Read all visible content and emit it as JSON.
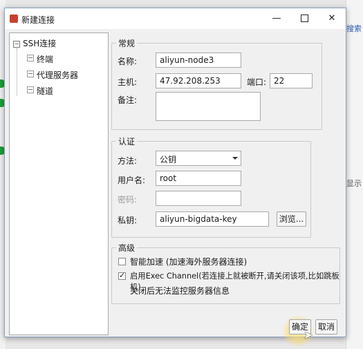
{
  "background": {
    "right_link": "搜索",
    "right_text": "显示"
  },
  "window": {
    "title": "新建连接",
    "minimize_glyph": "—",
    "close_glyph": "✕"
  },
  "tree": {
    "root": "SSH连接",
    "children": [
      "终端",
      "代理服务器",
      "隧道"
    ]
  },
  "general": {
    "legend": "常规",
    "name_label": "名称:",
    "name_value": "aliyun-node3",
    "host_label": "主机:",
    "host_value": "47.92.208.253",
    "port_label": "端口:",
    "port_value": "22",
    "note_label": "备注:",
    "note_value": ""
  },
  "auth": {
    "legend": "认证",
    "method_label": "方法:",
    "method_value": "公钥",
    "user_label": "用户名:",
    "user_value": "root",
    "password_label": "密码:",
    "password_value": "",
    "key_label": "私钥:",
    "key_value": "aliyun-bigdata-key",
    "browse_button": "浏览..."
  },
  "advanced": {
    "legend": "高级",
    "smart_accel": {
      "label": "智能加速 (加速海外服务器连接)",
      "checked": false
    },
    "exec_channel": {
      "label": "启用Exec Channel(若连接上就被断开,请关闭该项,比如跳板机)",
      "checked": true
    },
    "exec_note": "关闭后无法监控服务器信息"
  },
  "footer": {
    "ok_button": "确定",
    "cancel_button": "取消"
  },
  "icons": {
    "app": "app-icon",
    "cursor": "mouse-pointer-icon"
  }
}
